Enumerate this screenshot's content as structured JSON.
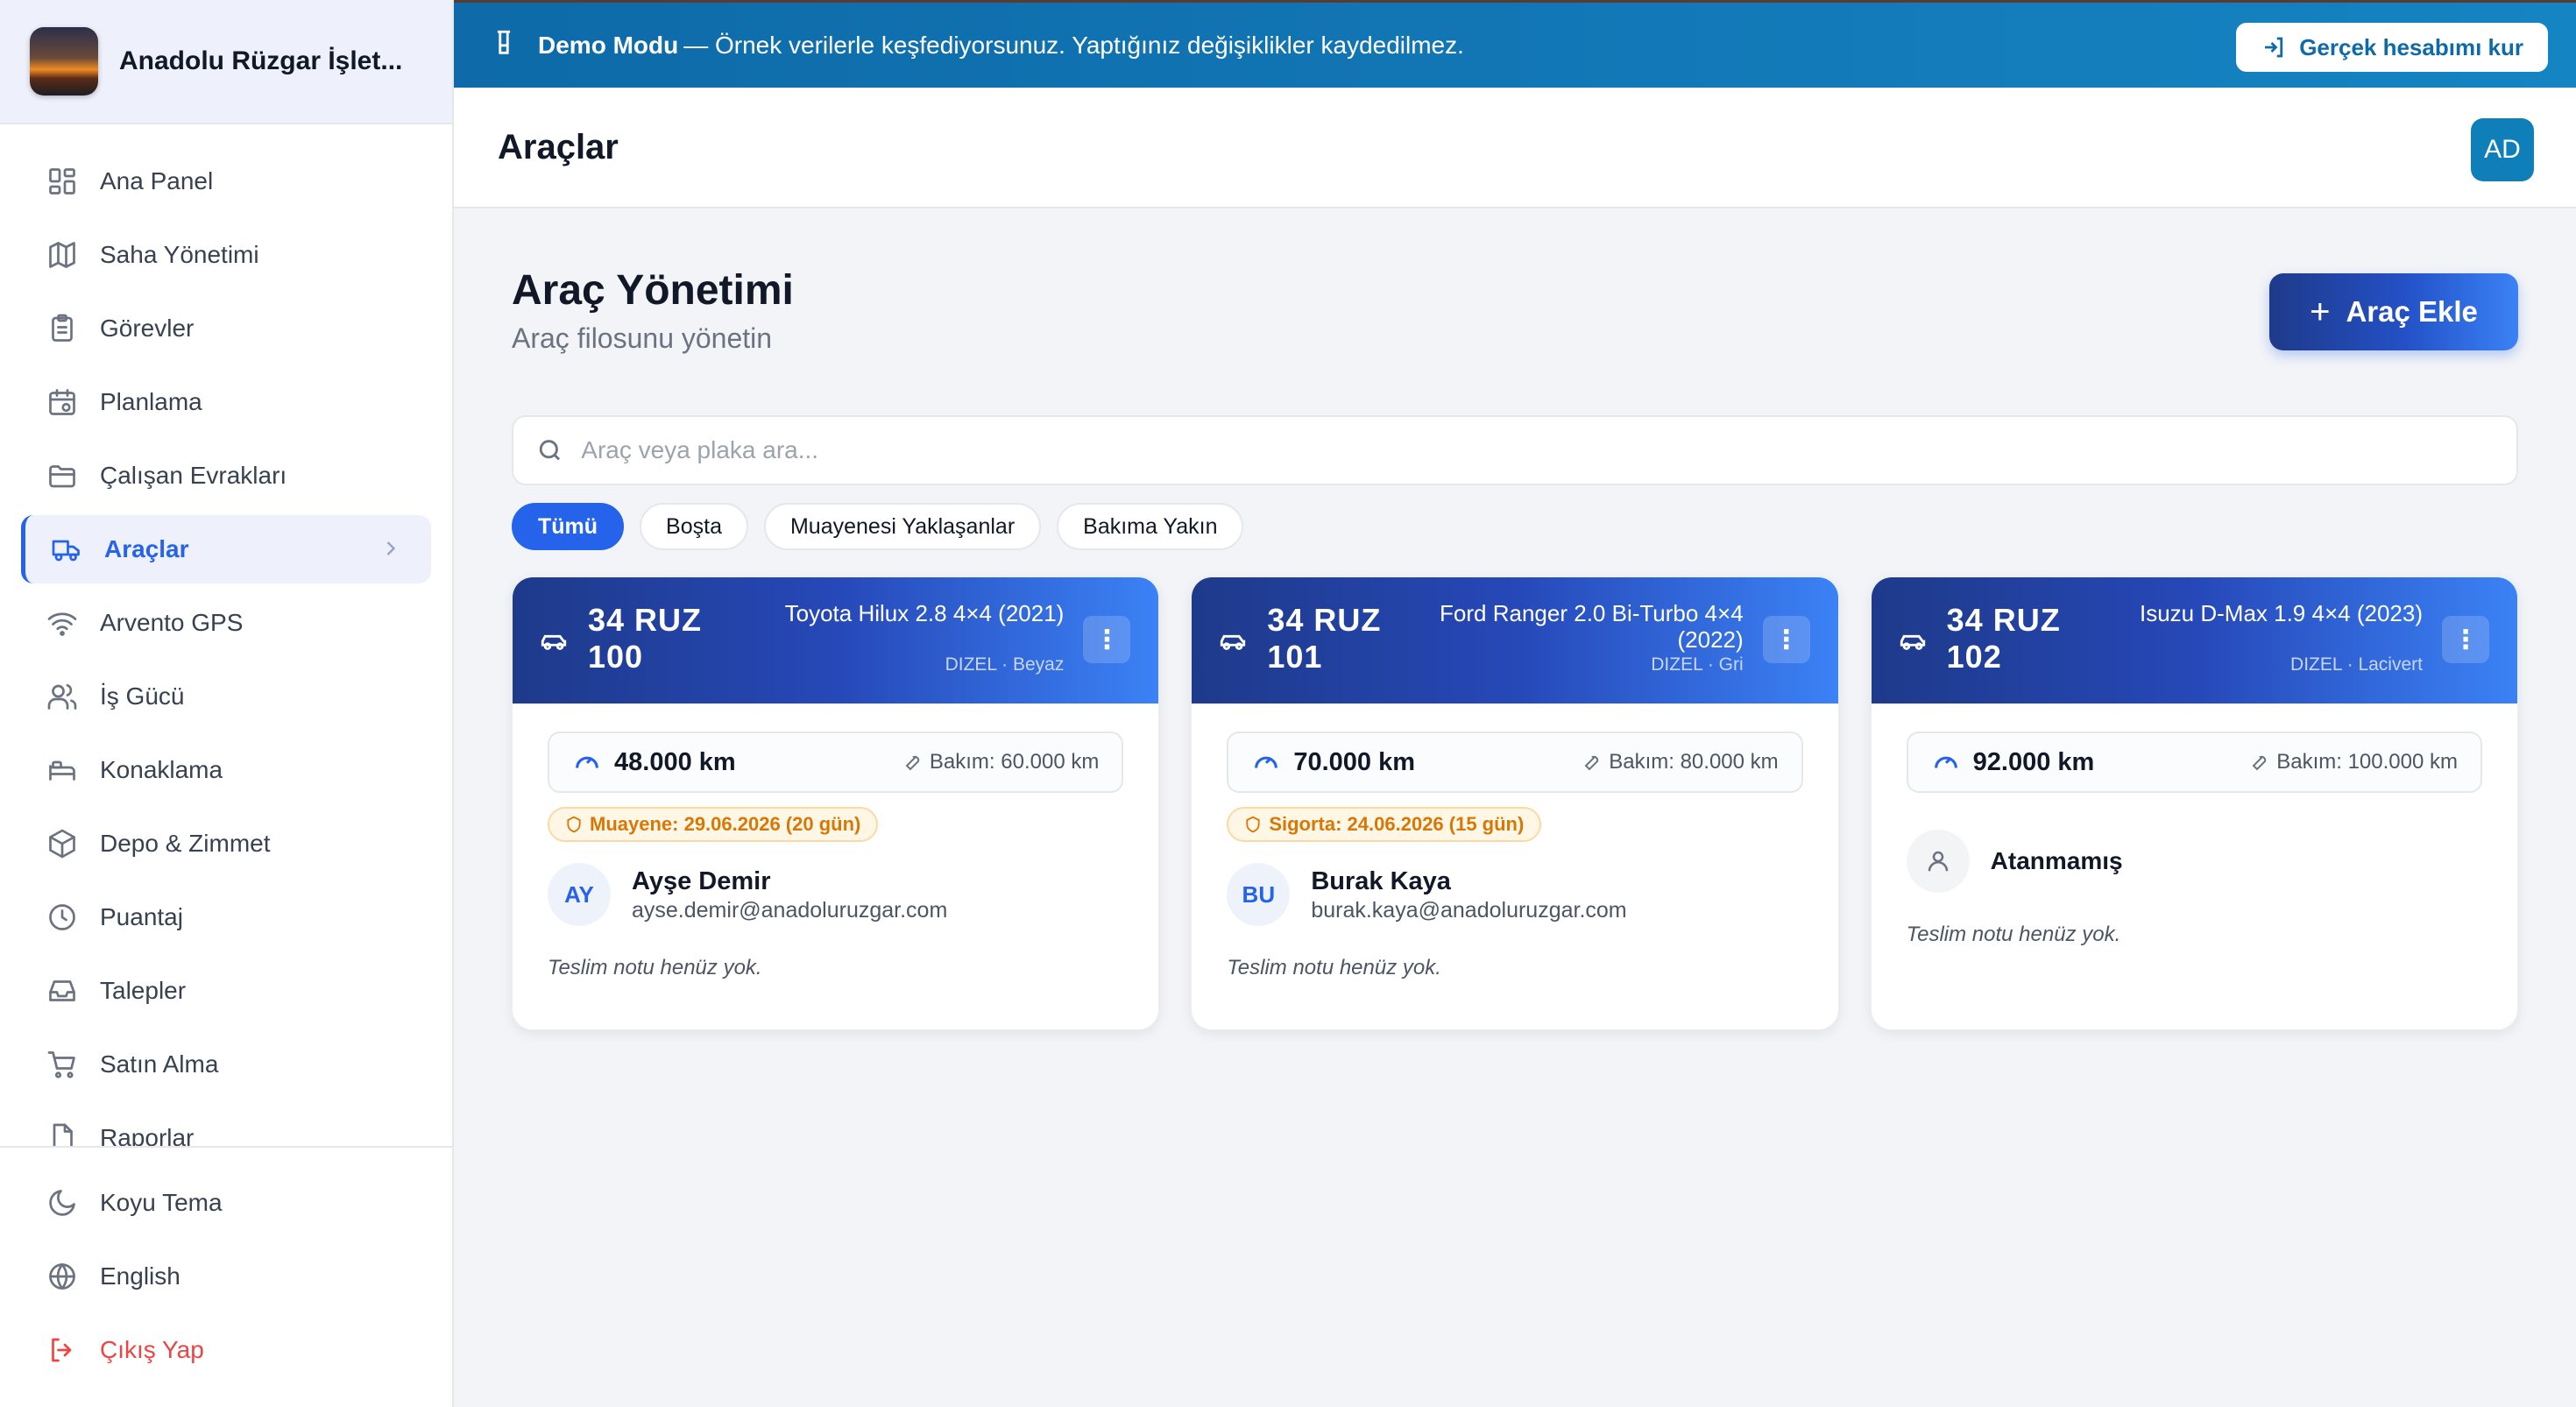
{
  "brand": {
    "name": "Anadolu Rüzgar İşlet..."
  },
  "sidebar": {
    "items": [
      {
        "label": "Ana Panel",
        "icon": "dashboard-icon"
      },
      {
        "label": "Saha Yönetimi",
        "icon": "map-icon"
      },
      {
        "label": "Görevler",
        "icon": "clipboard-icon"
      },
      {
        "label": "Planlama",
        "icon": "calendar-icon"
      },
      {
        "label": "Çalışan Evrakları",
        "icon": "folder-icon"
      },
      {
        "label": "Araçlar",
        "icon": "truck-icon",
        "active": true
      },
      {
        "label": "Arvento GPS",
        "icon": "wifi-icon"
      },
      {
        "label": "İş Gücü",
        "icon": "users-icon"
      },
      {
        "label": "Konaklama",
        "icon": "bed-icon"
      },
      {
        "label": "Depo & Zimmet",
        "icon": "package-icon"
      },
      {
        "label": "Puantaj",
        "icon": "clock-icon"
      },
      {
        "label": "Talepler",
        "icon": "inbox-icon"
      },
      {
        "label": "Satın Alma",
        "icon": "cart-icon"
      },
      {
        "label": "Raporlar",
        "icon": "file-icon"
      }
    ],
    "bottom": [
      {
        "label": "Koyu Tema",
        "icon": "moon-icon"
      },
      {
        "label": "English",
        "icon": "globe-icon"
      },
      {
        "label": "Çıkış Yap",
        "icon": "logout-icon"
      }
    ]
  },
  "banner": {
    "title": "Demo Modu",
    "text": "— Örnek verilerle keşfediyorsunuz. Yaptığınız değişiklikler kaydedilmez.",
    "button": "Gerçek hesabımı kur"
  },
  "header": {
    "title": "Araçlar",
    "avatar": "AD"
  },
  "page": {
    "title": "Araç Yönetimi",
    "subtitle": "Araç filosunu yönetin",
    "add_button": "Araç Ekle",
    "search_placeholder": "Araç veya plaka ara..."
  },
  "filters": [
    "Tümü",
    "Boşta",
    "Muayenesi Yaklaşanlar",
    "Bakıma Yakın"
  ],
  "vehicles": [
    {
      "plate": "34 RUZ 100",
      "model": "Toyota Hilux 2.8 4×4 (2021)",
      "fuel": "DIZEL · Beyaz",
      "km": "48.000 km",
      "maintenance": "Bakım: 60.000 km",
      "warning": "Muayene: 29.06.2026 (20 gün)",
      "initials": "AY",
      "driver": "Ayşe Demir",
      "email": "ayse.demir@anadoluruzgar.com",
      "note": "Teslim notu henüz yok."
    },
    {
      "plate": "34 RUZ 101",
      "model": "Ford Ranger 2.0 Bi-Turbo 4×4 (2022)",
      "fuel": "DIZEL · Gri",
      "km": "70.000 km",
      "maintenance": "Bakım: 80.000 km",
      "warning": "Sigorta: 24.06.2026 (15 gün)",
      "initials": "BU",
      "driver": "Burak Kaya",
      "email": "burak.kaya@anadoluruzgar.com",
      "note": "Teslim notu henüz yok."
    },
    {
      "plate": "34 RUZ 102",
      "model": "Isuzu D-Max 1.9 4×4 (2023)",
      "fuel": "DIZEL · Lacivert",
      "km": "92.000 km",
      "maintenance": "Bakım: 100.000 km",
      "driver": "Atanmamış",
      "note": "Teslim notu henüz yok."
    }
  ]
}
